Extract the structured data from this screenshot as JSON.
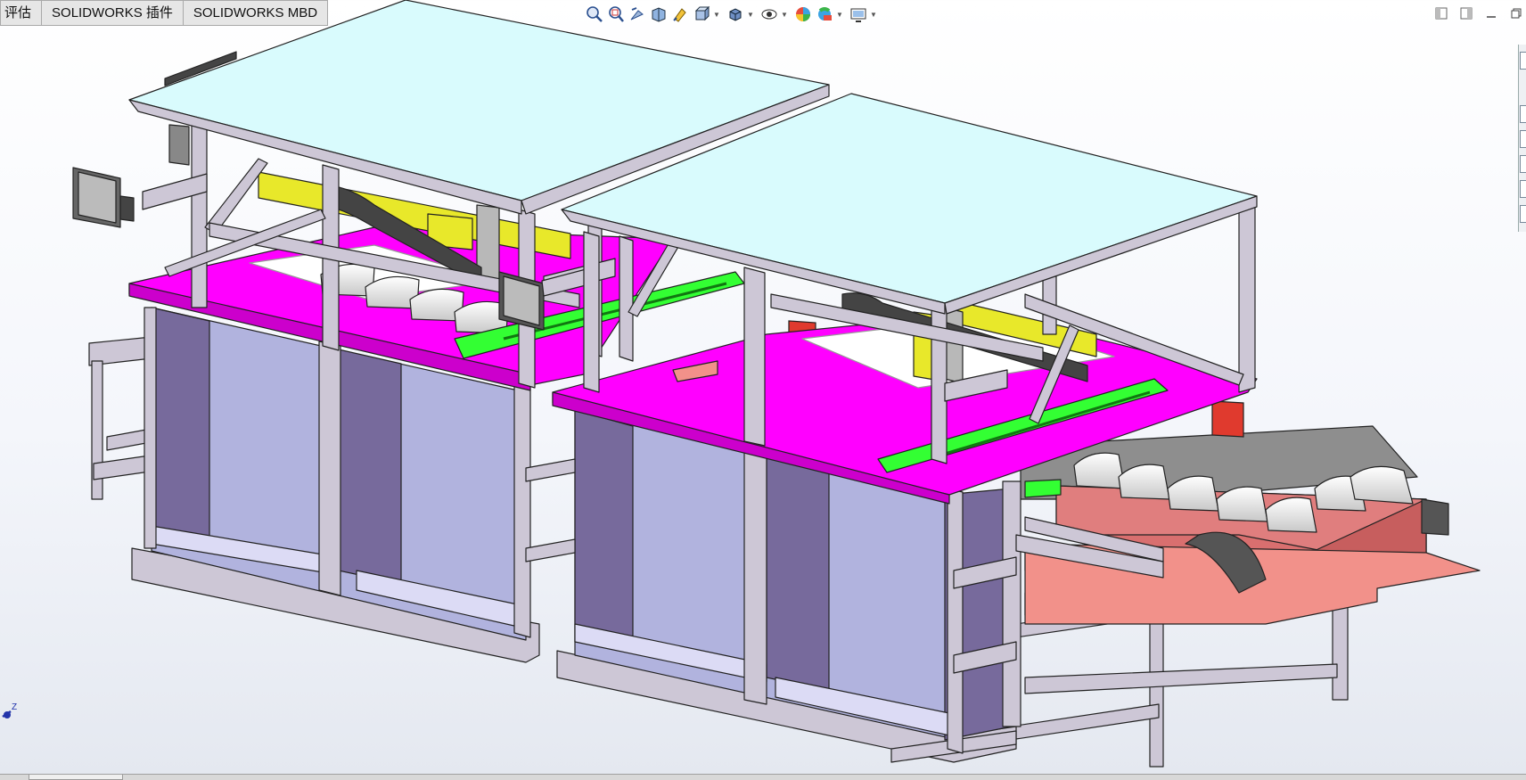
{
  "tabs": [
    {
      "label": "评估"
    },
    {
      "label": "SOLIDWORKS 插件"
    },
    {
      "label": "SOLIDWORKS MBD"
    }
  ],
  "heads_up_toolbar": [
    {
      "icon": "zoom-to-fit-icon"
    },
    {
      "icon": "zoom-to-area-icon"
    },
    {
      "icon": "previous-view-icon"
    },
    {
      "icon": "section-view-icon"
    },
    {
      "icon": "dynamic-annotation-views-icon"
    },
    {
      "icon": "view-orientation-icon",
      "has_dropdown": true
    },
    {
      "icon": "display-style-icon",
      "has_dropdown": true
    },
    {
      "icon": "hide-show-items-icon",
      "has_dropdown": true
    },
    {
      "icon": "edit-appearance-icon"
    },
    {
      "icon": "apply-scene-icon",
      "has_dropdown": true
    },
    {
      "icon": "view-settings-icon",
      "has_dropdown": true
    }
  ],
  "triad": {
    "axis_label": "Z"
  },
  "colors": {
    "roof": "#d9fbfd",
    "frame": "#cdc7d6",
    "magenta_plate": "#ff00ff",
    "green_rail": "#33ff33",
    "yellow_gantry": "#e8e82a",
    "cabinet_side": "#776a9c",
    "cabinet_inner": "#b1b3de",
    "red_column": "#e03a2e",
    "conveyor_plate": "#f2918a",
    "viewport_bg": "#f4f6fb"
  }
}
